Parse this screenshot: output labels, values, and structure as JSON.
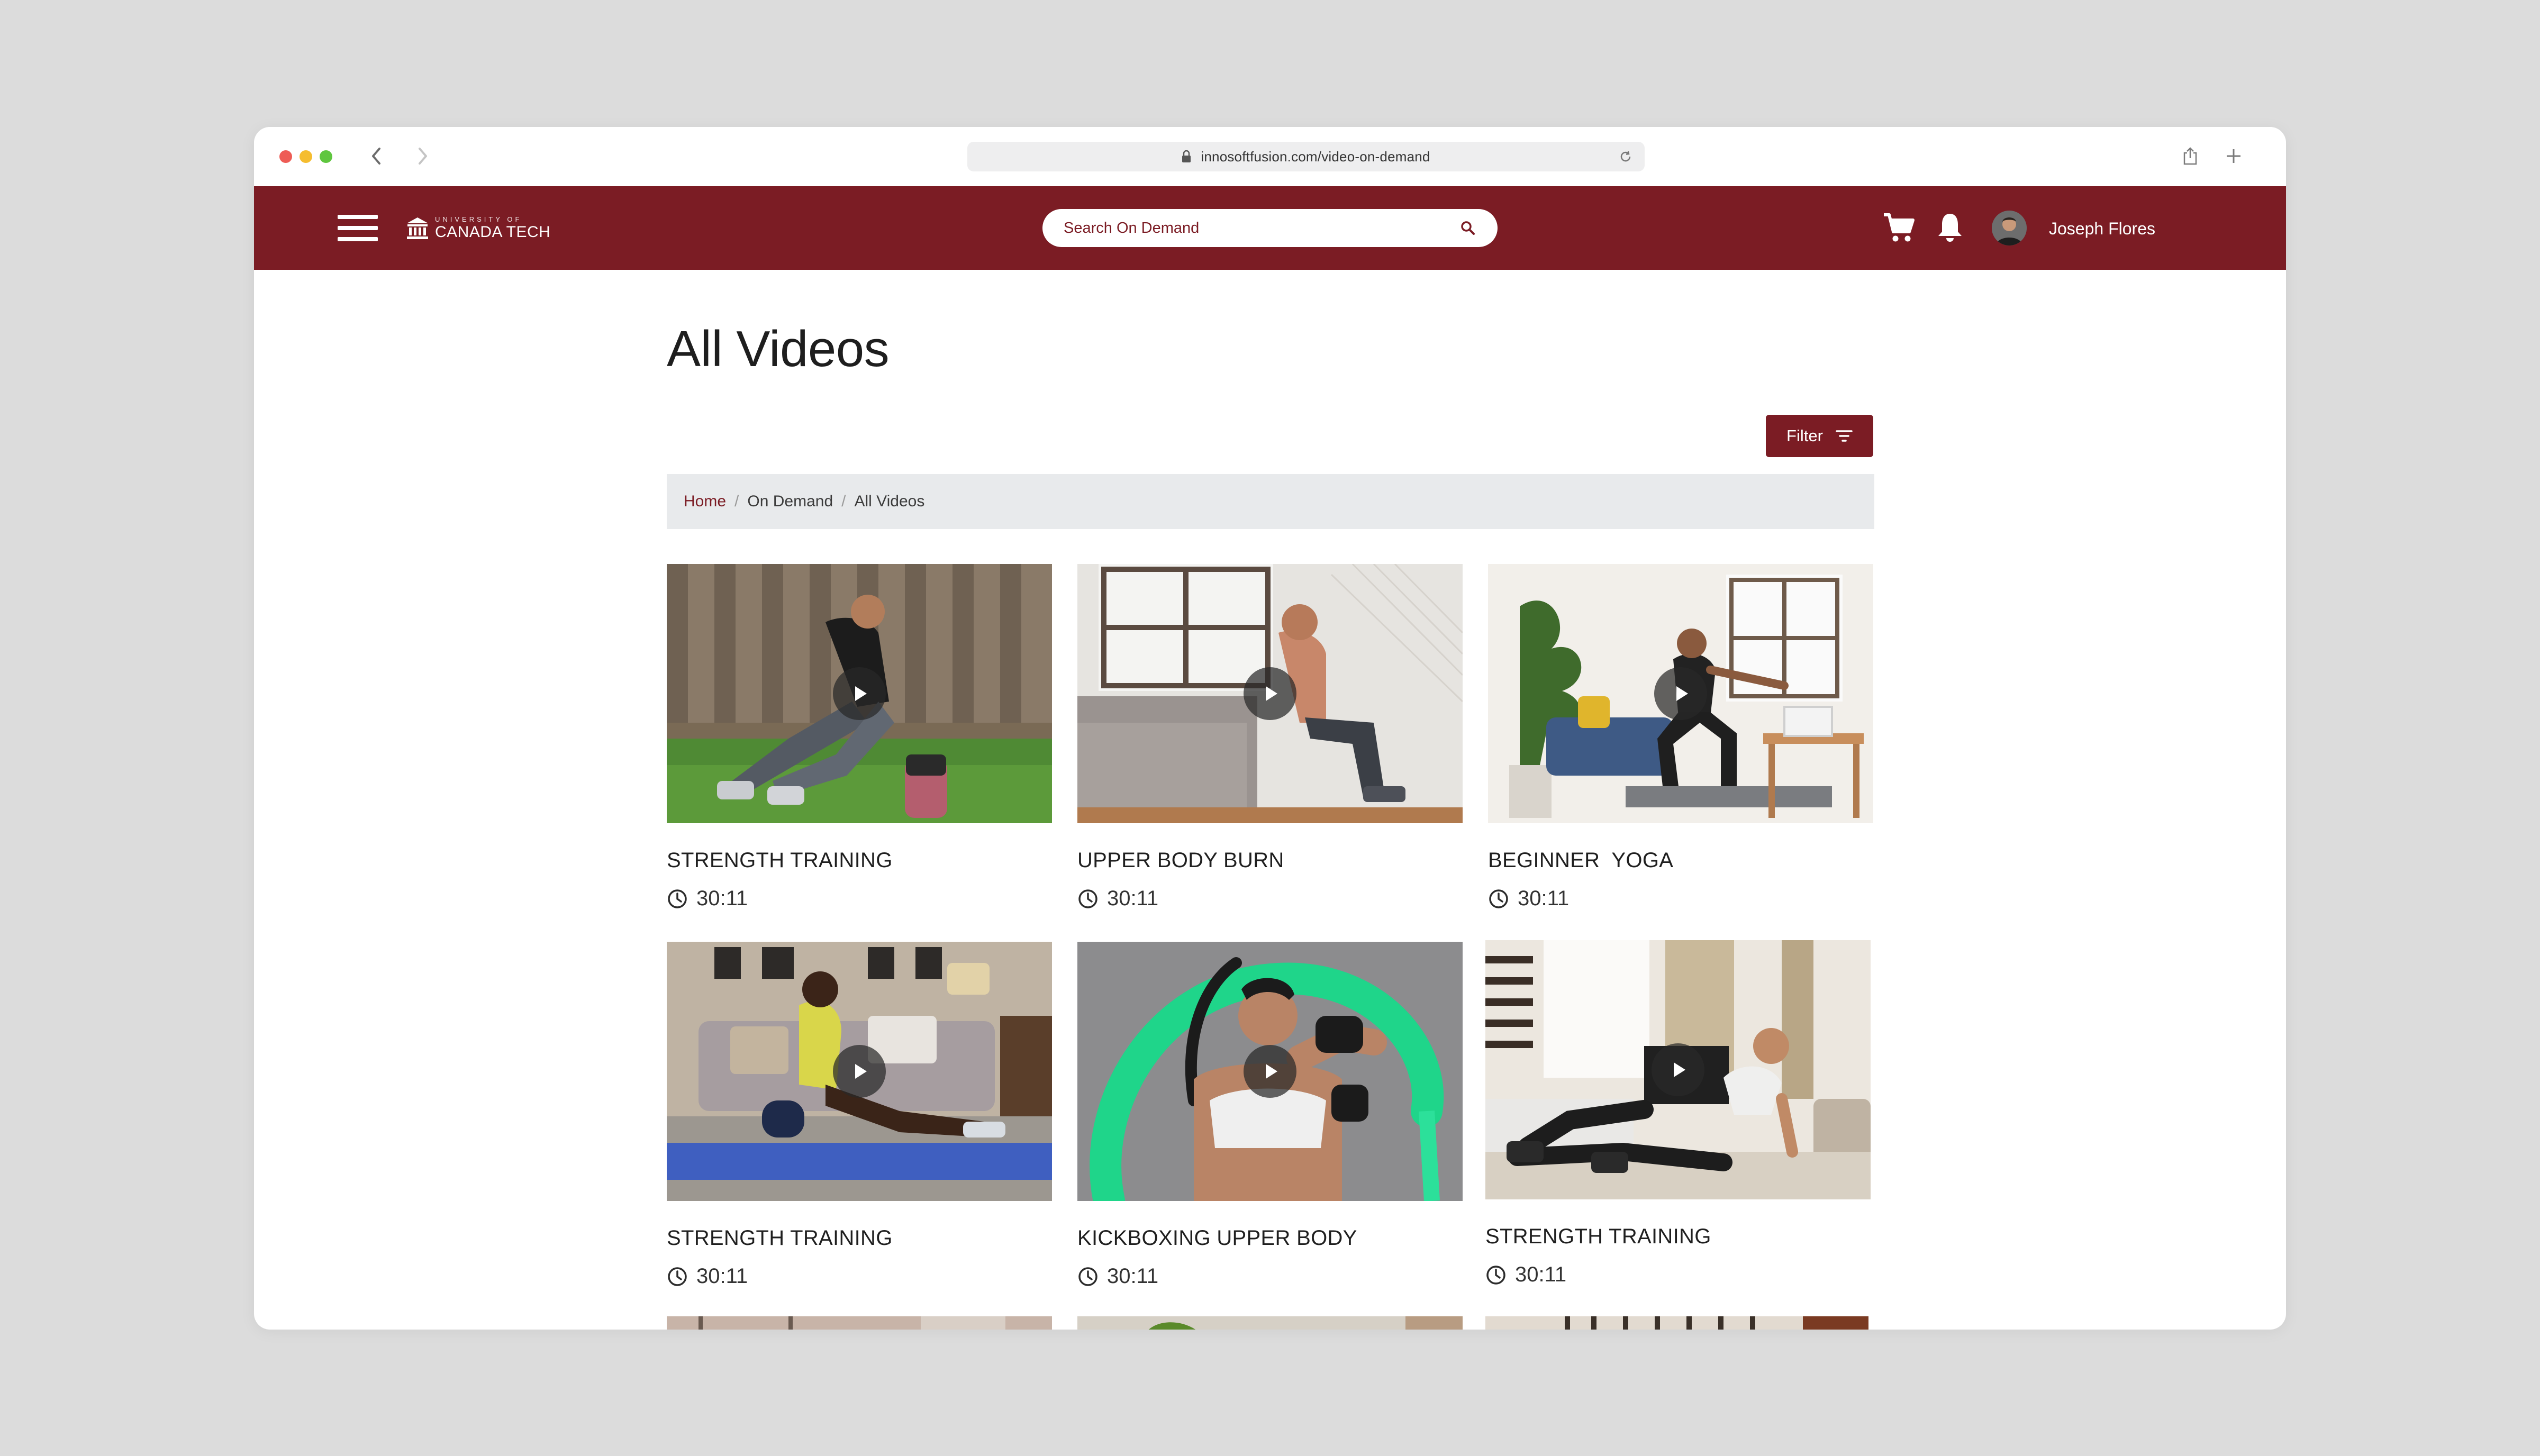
{
  "browser": {
    "url": "innosoftfusion.com/video-on-demand"
  },
  "header": {
    "logo_small": "UNIVERSITY OF",
    "logo_big": "CANADA TECH",
    "search_placeholder": "Search On Demand",
    "username": "Joseph Flores"
  },
  "page": {
    "title": "All Videos",
    "filter_label": "Filter"
  },
  "breadcrumb": {
    "home": "Home",
    "on_demand": "On Demand",
    "current": "All Videos"
  },
  "videos": [
    {
      "title": "STRENGTH TRAINING",
      "duration": "30:11"
    },
    {
      "title": "UPPER BODY BURN",
      "duration": "30:11"
    },
    {
      "title": "BEGINNER  YOGA",
      "duration": "30:11"
    },
    {
      "title": "STRENGTH TRAINING",
      "duration": "30:11"
    },
    {
      "title": "KICKBOXING UPPER BODY",
      "duration": "30:11"
    },
    {
      "title": "STRENGTH TRAINING",
      "duration": "30:11"
    }
  ],
  "colors": {
    "brand": "#7b1c24",
    "breadcrumb_bg": "#e8eaec",
    "page_bg": "#dcdcdc"
  }
}
